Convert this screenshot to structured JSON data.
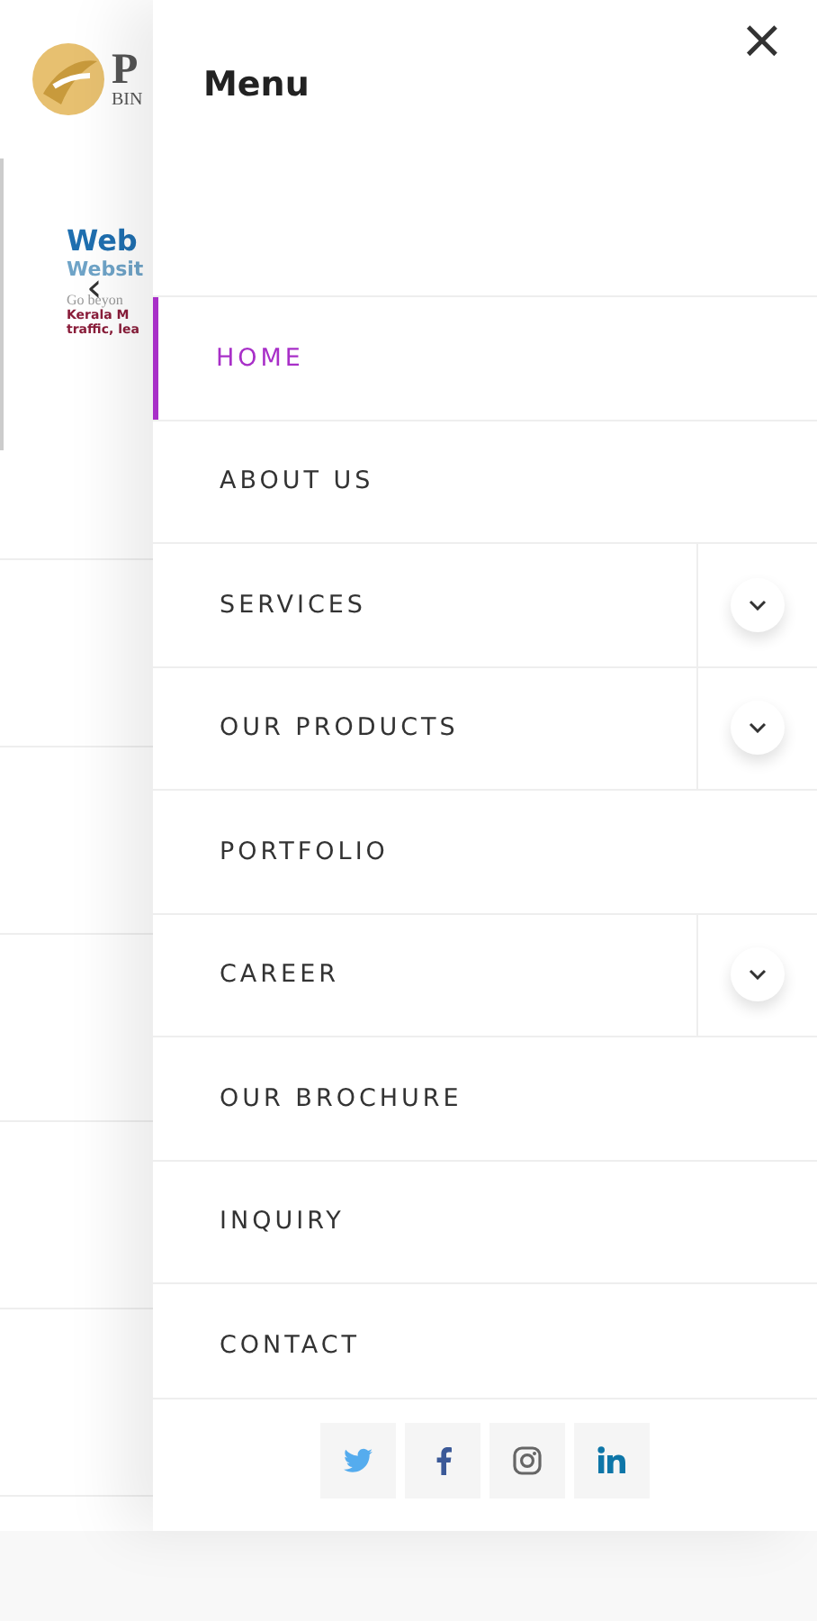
{
  "background_page": {
    "logo": {
      "letter": "P",
      "subtitle": "BIN"
    },
    "slide": {
      "title": "Web",
      "subtitle": "Websit",
      "tagline": "Go beyon",
      "body_lines": [
        "Kerala M",
        "traffic, lea"
      ],
      "prev_arrow": "‹"
    }
  },
  "drawer": {
    "title": "Menu",
    "close": "×",
    "items": [
      {
        "label": "HOME",
        "selected": true,
        "has_submenu": false
      },
      {
        "label": "ABOUT US",
        "selected": false,
        "has_submenu": false
      },
      {
        "label": "SERVICES",
        "selected": false,
        "has_submenu": true
      },
      {
        "label": "OUR PRODUCTS",
        "selected": false,
        "has_submenu": true
      },
      {
        "label": "PORTFOLIO",
        "selected": false,
        "has_submenu": false
      },
      {
        "label": "CAREER",
        "selected": false,
        "has_submenu": true
      },
      {
        "label": "OUR BROCHURE",
        "selected": false,
        "has_submenu": false
      },
      {
        "label": "INQUIRY",
        "selected": false,
        "has_submenu": false
      },
      {
        "label": "CONTACT",
        "selected": false,
        "has_submenu": false
      }
    ],
    "social": [
      {
        "kind": "twitter"
      },
      {
        "kind": "facebook"
      },
      {
        "kind": "instagram"
      },
      {
        "kind": "linkedin"
      }
    ]
  }
}
